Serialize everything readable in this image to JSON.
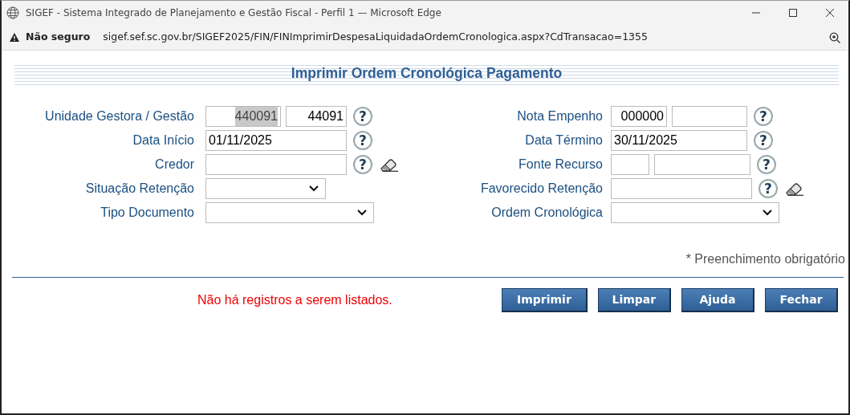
{
  "window": {
    "title": "SIGEF - Sistema Integrado de Planejamento e Gestão Fiscal - Perfil 1 — Microsoft Edge"
  },
  "address_bar": {
    "security": "Não seguro",
    "url": "sigef.sef.sc.gov.br/SIGEF2025/FIN/FINImprimirDespesaLiquidadaOrdemCronologica.aspx?CdTransacao=1355"
  },
  "page_title": "Imprimir Ordem Cronológica Pagamento",
  "left_fields": [
    {
      "label": "Unidade Gestora / Gestão",
      "kind": "text",
      "inputs": [
        {
          "kind": "filled",
          "value": "440091",
          "highlighted": true
        },
        {
          "kind": "filled",
          "value": "44091",
          "highlighted": false
        }
      ],
      "help": "?",
      "eraser": false
    },
    {
      "label": "Data Início",
      "kind": "text",
      "inputs": [
        {
          "kind": "filled",
          "value": "01/11/2025",
          "highlighted": false
        }
      ],
      "help": "?",
      "eraser": false
    },
    {
      "label": "Credor",
      "kind": "text",
      "inputs": [
        {
          "kind": "blank"
        }
      ],
      "help": "?",
      "eraser": true
    },
    {
      "label": "Situação Retenção",
      "kind": "select",
      "eraser": false
    },
    {
      "label": "Tipo Documento",
      "kind": "select",
      "eraser": false
    }
  ],
  "right_fields": [
    {
      "label": "Nota Empenho",
      "kind": "text",
      "inputs": [
        {
          "kind": "filled",
          "value": "000000",
          "highlighted": false
        },
        {
          "kind": "blank"
        }
      ],
      "help": "?",
      "eraser": false
    },
    {
      "label": "Data Término",
      "kind": "text",
      "inputs": [
        {
          "kind": "filled",
          "value": "30/11/2025",
          "highlighted": false
        }
      ],
      "help": "?",
      "eraser": false
    },
    {
      "label": "Fonte Recurso",
      "kind": "text",
      "inputs": [
        {
          "kind": "blank"
        },
        {
          "kind": "blank"
        }
      ],
      "help": "?",
      "eraser": false
    },
    {
      "label": "Favorecido Retenção",
      "kind": "text",
      "inputs": [
        {
          "kind": "blank"
        }
      ],
      "help": "?",
      "eraser": true
    },
    {
      "label": "Ordem Cronológica",
      "kind": "select",
      "eraser": false
    }
  ],
  "required_note": "* Preenchimento obrigatório",
  "message": "Não há registros a serem listados.",
  "buttons": [
    "Imprimir",
    "Limpar",
    "Ajuda",
    "Fechar"
  ]
}
